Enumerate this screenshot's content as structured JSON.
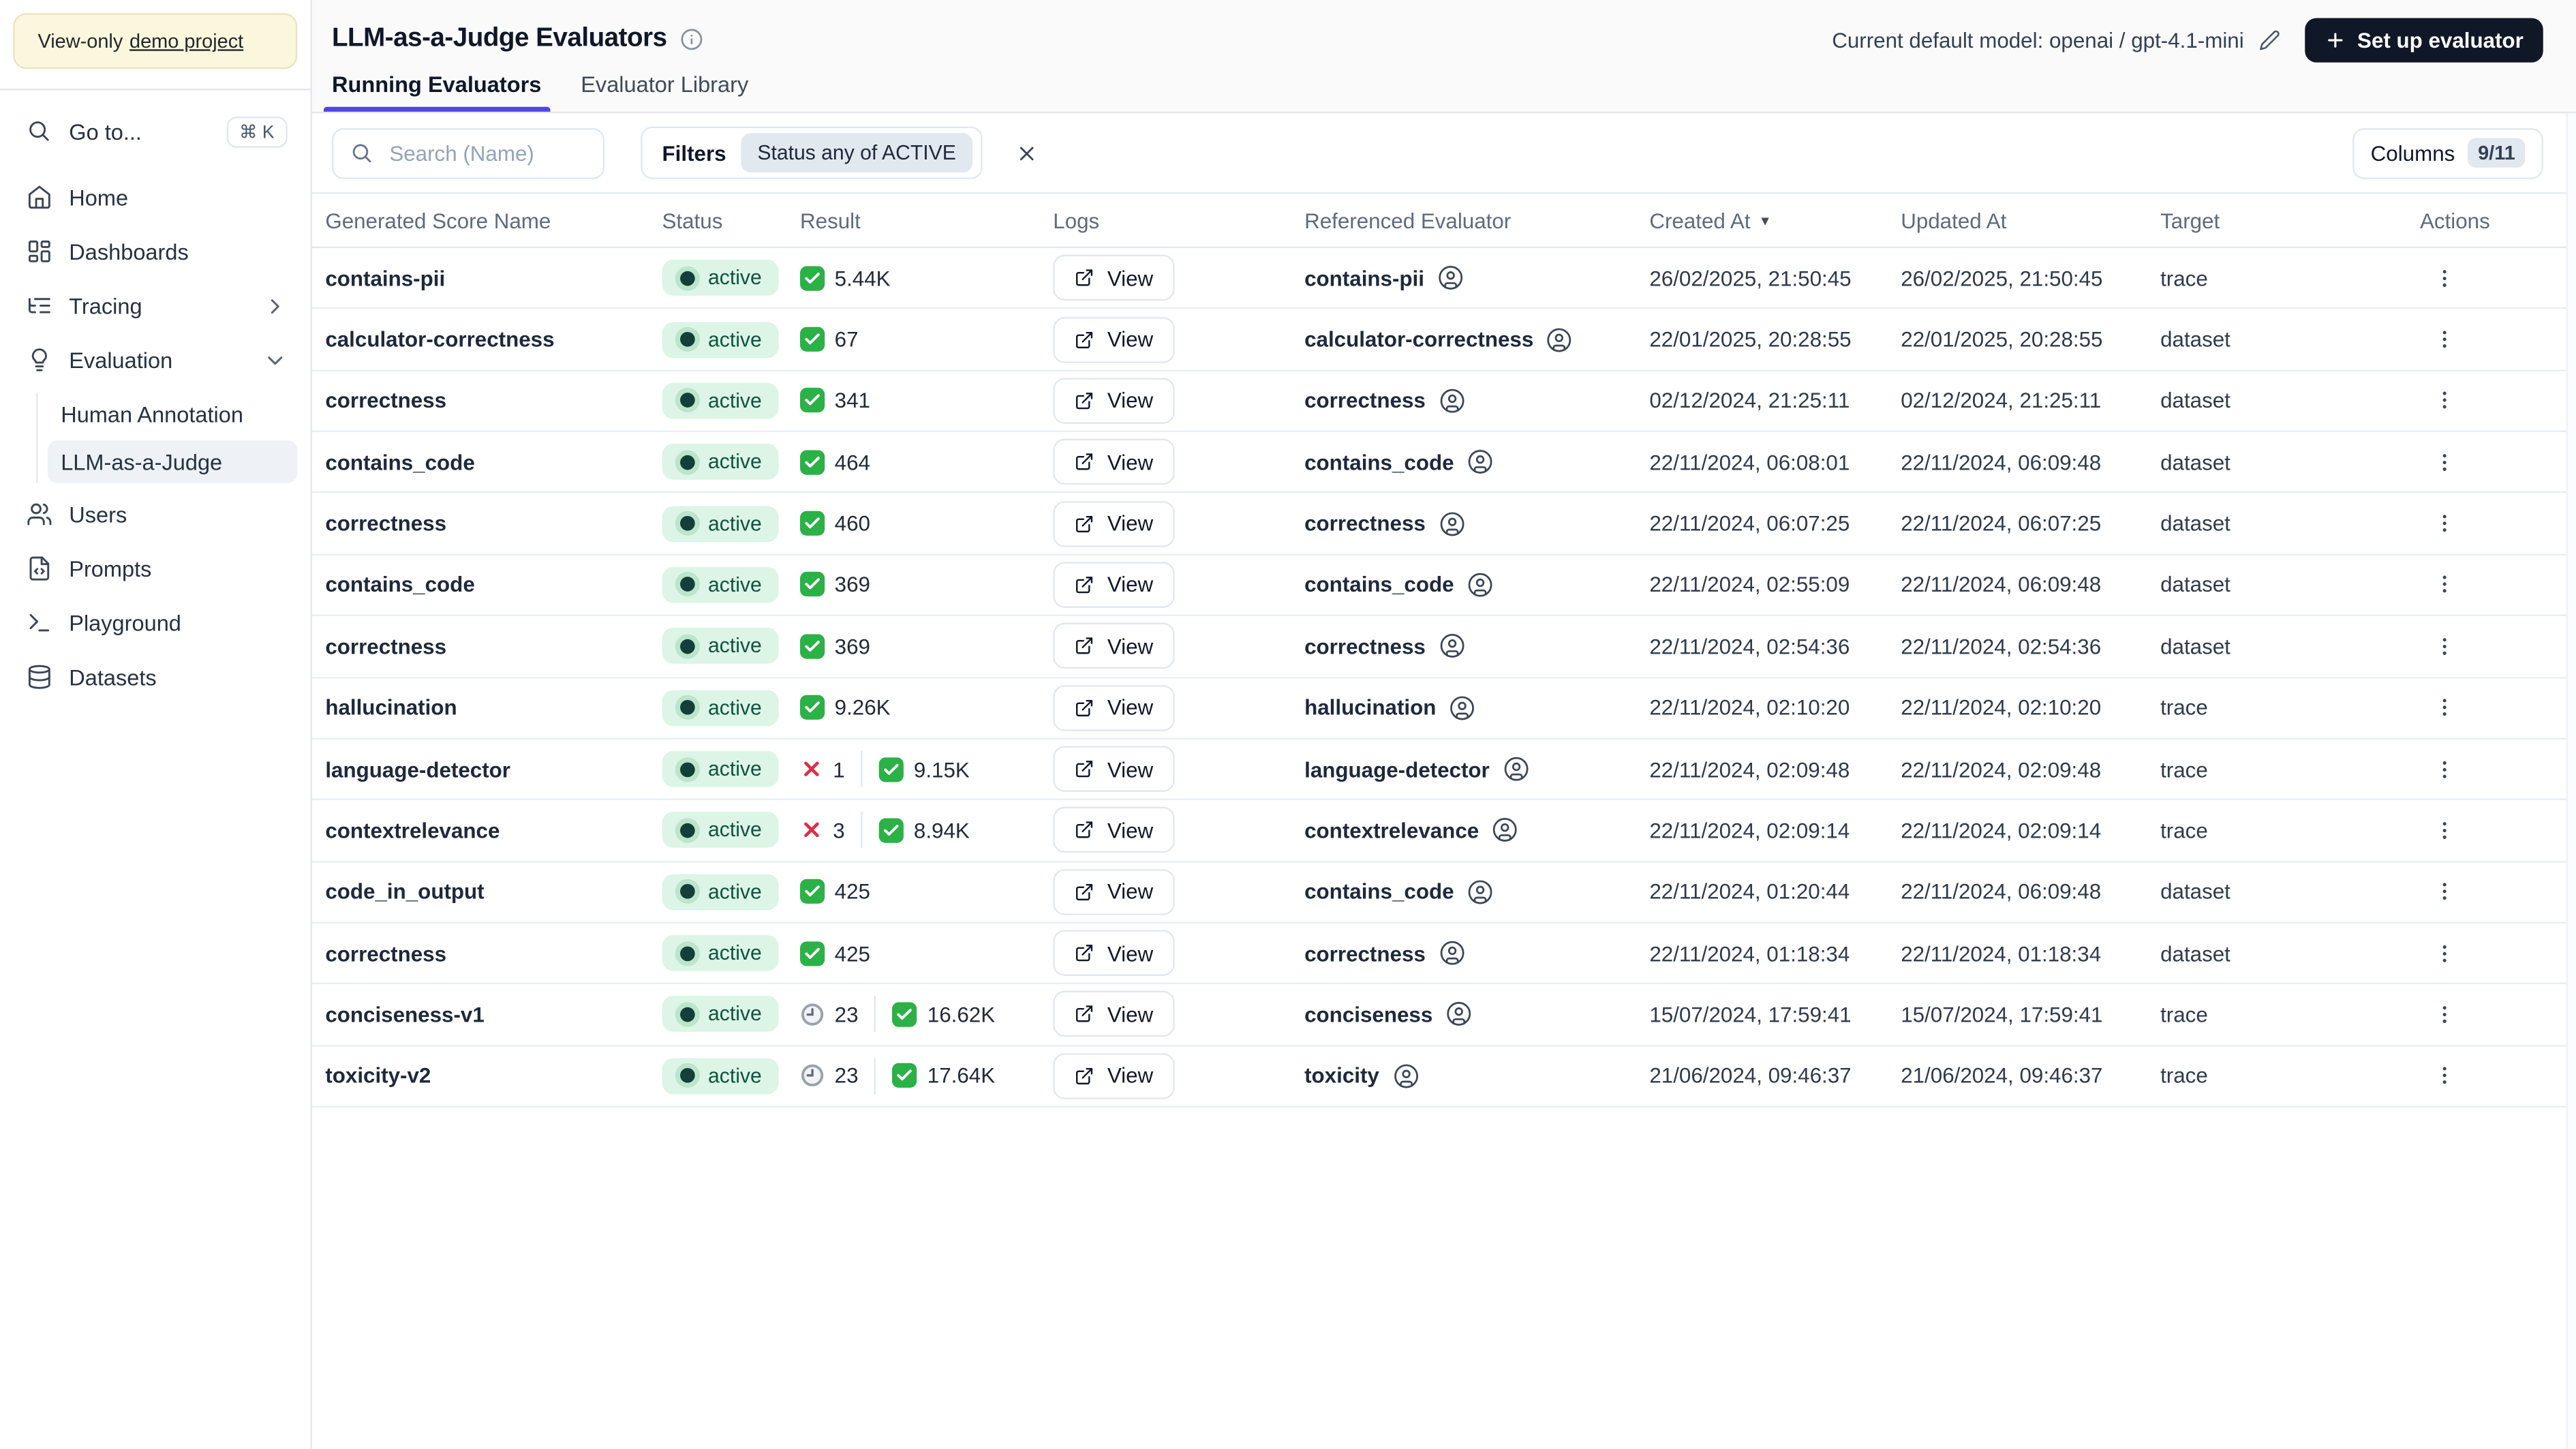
{
  "banner": {
    "prefix": "View-only",
    "link_text": "demo project"
  },
  "sidebar": {
    "goto_label": "Go to...",
    "goto_shortcut": "⌘ K",
    "items": [
      {
        "label": "Home",
        "icon": "home"
      },
      {
        "label": "Dashboards",
        "icon": "dashboards"
      },
      {
        "label": "Tracing",
        "icon": "tracing",
        "chevron": "right"
      },
      {
        "label": "Evaluation",
        "icon": "evaluation",
        "chevron": "down",
        "children": [
          "Human Annotation",
          "LLM-as-a-Judge"
        ],
        "active_child": "LLM-as-a-Judge"
      },
      {
        "label": "Users",
        "icon": "users"
      },
      {
        "label": "Prompts",
        "icon": "prompts"
      },
      {
        "label": "Playground",
        "icon": "playground"
      },
      {
        "label": "Datasets",
        "icon": "datasets"
      }
    ]
  },
  "header": {
    "title": "LLM-as-a-Judge Evaluators",
    "default_model_label": "Current default model: openai / gpt-4.1-mini",
    "setup_button_label": "Set up evaluator"
  },
  "tabs": [
    {
      "label": "Running Evaluators",
      "active": true
    },
    {
      "label": "Evaluator Library",
      "active": false
    }
  ],
  "filter_bar": {
    "search_placeholder": "Search (Name)",
    "filters_label": "Filters",
    "filter_chip": "Status any of ACTIVE",
    "columns_label": "Columns",
    "columns_badge": "9/11"
  },
  "table": {
    "columns": [
      "Generated Score Name",
      "Status",
      "Result",
      "Logs",
      "Referenced Evaluator",
      "Created At",
      "Updated At",
      "Target",
      "Actions"
    ],
    "sorted_column": "Created At",
    "sort_direction": "desc",
    "logs_button_label": "View",
    "rows": [
      {
        "name": "contains-pii",
        "status": "active",
        "result": [
          {
            "kind": "pass",
            "value": "5.44K"
          }
        ],
        "evaluator": "contains-pii",
        "created": "26/02/2025, 21:50:45",
        "updated": "26/02/2025, 21:50:45",
        "target": "trace"
      },
      {
        "name": "calculator-correctness",
        "status": "active",
        "result": [
          {
            "kind": "pass",
            "value": "67"
          }
        ],
        "evaluator": "calculator-correctness",
        "created": "22/01/2025, 20:28:55",
        "updated": "22/01/2025, 20:28:55",
        "target": "dataset"
      },
      {
        "name": "correctness",
        "status": "active",
        "result": [
          {
            "kind": "pass",
            "value": "341"
          }
        ],
        "evaluator": "correctness",
        "created": "02/12/2024, 21:25:11",
        "updated": "02/12/2024, 21:25:11",
        "target": "dataset"
      },
      {
        "name": "contains_code",
        "status": "active",
        "result": [
          {
            "kind": "pass",
            "value": "464"
          }
        ],
        "evaluator": "contains_code",
        "created": "22/11/2024, 06:08:01",
        "updated": "22/11/2024, 06:09:48",
        "target": "dataset"
      },
      {
        "name": "correctness",
        "status": "active",
        "result": [
          {
            "kind": "pass",
            "value": "460"
          }
        ],
        "evaluator": "correctness",
        "created": "22/11/2024, 06:07:25",
        "updated": "22/11/2024, 06:07:25",
        "target": "dataset"
      },
      {
        "name": "contains_code",
        "status": "active",
        "result": [
          {
            "kind": "pass",
            "value": "369"
          }
        ],
        "evaluator": "contains_code",
        "created": "22/11/2024, 02:55:09",
        "updated": "22/11/2024, 06:09:48",
        "target": "dataset"
      },
      {
        "name": "correctness",
        "status": "active",
        "result": [
          {
            "kind": "pass",
            "value": "369"
          }
        ],
        "evaluator": "correctness",
        "created": "22/11/2024, 02:54:36",
        "updated": "22/11/2024, 02:54:36",
        "target": "dataset"
      },
      {
        "name": "hallucination",
        "status": "active",
        "result": [
          {
            "kind": "pass",
            "value": "9.26K"
          }
        ],
        "evaluator": "hallucination",
        "created": "22/11/2024, 02:10:20",
        "updated": "22/11/2024, 02:10:20",
        "target": "trace"
      },
      {
        "name": "language-detector",
        "status": "active",
        "result": [
          {
            "kind": "fail",
            "value": "1"
          },
          {
            "kind": "pass",
            "value": "9.15K"
          }
        ],
        "evaluator": "language-detector",
        "created": "22/11/2024, 02:09:48",
        "updated": "22/11/2024, 02:09:48",
        "target": "trace"
      },
      {
        "name": "contextrelevance",
        "status": "active",
        "result": [
          {
            "kind": "fail",
            "value": "3"
          },
          {
            "kind": "pass",
            "value": "8.94K"
          }
        ],
        "evaluator": "contextrelevance",
        "created": "22/11/2024, 02:09:14",
        "updated": "22/11/2024, 02:09:14",
        "target": "trace"
      },
      {
        "name": "code_in_output",
        "status": "active",
        "result": [
          {
            "kind": "pass",
            "value": "425"
          }
        ],
        "evaluator": "contains_code",
        "created": "22/11/2024, 01:20:44",
        "updated": "22/11/2024, 06:09:48",
        "target": "dataset"
      },
      {
        "name": "correctness",
        "status": "active",
        "result": [
          {
            "kind": "pass",
            "value": "425"
          }
        ],
        "evaluator": "correctness",
        "created": "22/11/2024, 01:18:34",
        "updated": "22/11/2024, 01:18:34",
        "target": "dataset"
      },
      {
        "name": "conciseness-v1",
        "status": "active",
        "result": [
          {
            "kind": "pending",
            "value": "23"
          },
          {
            "kind": "pass",
            "value": "16.62K"
          }
        ],
        "evaluator": "conciseness",
        "created": "15/07/2024, 17:59:41",
        "updated": "15/07/2024, 17:59:41",
        "target": "trace"
      },
      {
        "name": "toxicity-v2",
        "status": "active",
        "result": [
          {
            "kind": "pending",
            "value": "23"
          },
          {
            "kind": "pass",
            "value": "17.64K"
          }
        ],
        "evaluator": "toxicity",
        "created": "21/06/2024, 09:46:37",
        "updated": "21/06/2024, 09:46:37",
        "target": "trace"
      }
    ]
  },
  "colors": {
    "accent": "#4f46e5",
    "status_active_bg": "#dcf5e6",
    "status_active_text": "#115240",
    "status_dot": "#123f39",
    "pass_green": "#2cb147",
    "fail_red": "#dd2f45",
    "primary_button_bg": "#101828",
    "banner_bg": "#fbf7dd"
  }
}
